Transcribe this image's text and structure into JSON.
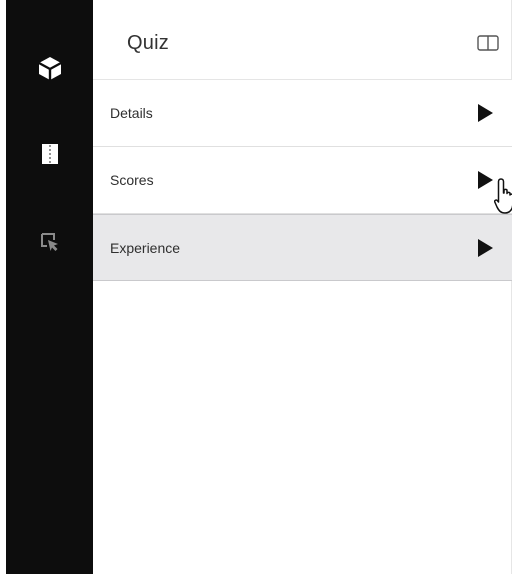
{
  "panel": {
    "title": "Quiz"
  },
  "rail": {
    "items": [
      {
        "icon": "cube-icon",
        "color": "#ffffff"
      },
      {
        "icon": "page-outline-icon",
        "color": "#ffffff"
      },
      {
        "icon": "cursor-select-icon",
        "color": "#8a8a8a"
      }
    ]
  },
  "sections": [
    {
      "label": "Details"
    },
    {
      "label": "Scores"
    },
    {
      "label": "Experience"
    }
  ],
  "colors": {
    "rail_bg": "#0d0d0d",
    "active_section_bg": "#e8e8ea"
  }
}
